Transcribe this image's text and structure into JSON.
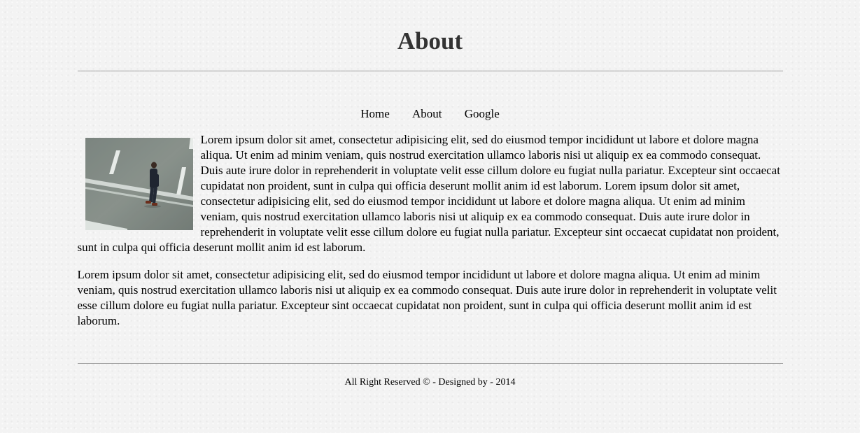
{
  "header": {
    "title": "About"
  },
  "nav": {
    "items": [
      {
        "label": "Home"
      },
      {
        "label": "About"
      },
      {
        "label": "Google"
      }
    ]
  },
  "content": {
    "paragraph_1": "Lorem ipsum dolor sit amet, consectetur adipisicing elit, sed do eiusmod tempor incididunt ut labore et dolore magna aliqua. Ut enim ad minim veniam, quis nostrud exercitation ullamco laboris nisi ut aliquip ex ea commodo consequat. Duis aute irure dolor in reprehenderit in voluptate velit esse cillum dolore eu fugiat nulla pariatur. Excepteur sint occaecat cupidatat non proident, sunt in culpa qui officia deserunt mollit anim id est laborum. Lorem ipsum dolor sit amet, consectetur adipisicing elit, sed do eiusmod tempor incididunt ut labore et dolore magna aliqua. Ut enim ad minim veniam, quis nostrud exercitation ullamco laboris nisi ut aliquip ex ea commodo consequat. Duis aute irure dolor in reprehenderit in voluptate velit esse cillum dolore eu fugiat nulla pariatur. Excepteur sint occaecat cupidatat non proident, sunt in culpa qui officia deserunt mollit anim id est laborum.",
    "paragraph_2": "Lorem ipsum dolor sit amet, consectetur adipisicing elit, sed do eiusmod tempor incididunt ut labore et dolore magna aliqua. Ut enim ad minim veniam, quis nostrud exercitation ullamco laboris nisi ut aliquip ex ea commodo consequat. Duis aute irure dolor in reprehenderit in voluptate velit esse cillum dolore eu fugiat nulla pariatur. Excepteur sint occaecat cupidatat non proident, sunt in culpa qui officia deserunt mollit anim id est laborum."
  },
  "footer": {
    "text": "All Right Reserved © - Designed by - 2014"
  },
  "colors": {
    "background": "#f3f3f3",
    "title": "#333333",
    "rule": "#9a9a9a",
    "text": "#000000"
  }
}
